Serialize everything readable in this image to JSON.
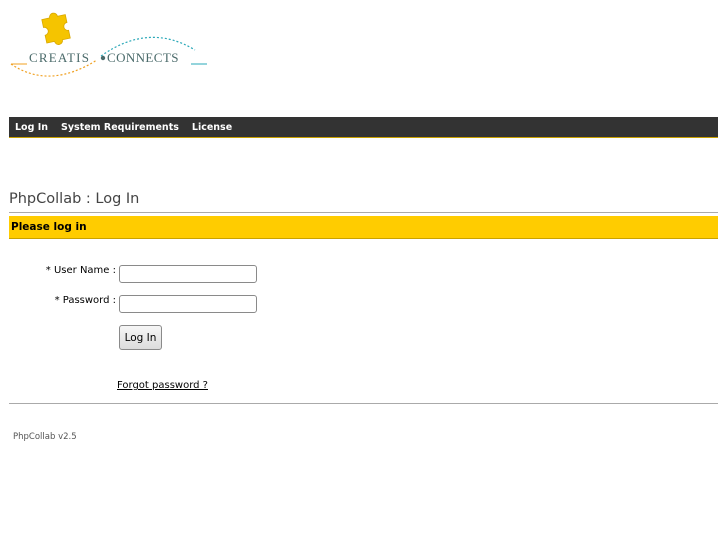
{
  "logo": {
    "brand_left": "CREATIS",
    "brand_right": "CONNECTS",
    "colors": {
      "puzzle": "#f5c400",
      "text": "#4a6a6a",
      "swirl_orange": "#f0a020",
      "swirl_teal": "#2aa8b8"
    }
  },
  "nav": {
    "items": [
      {
        "label": "Log In"
      },
      {
        "label": "System Requirements"
      },
      {
        "label": "License"
      }
    ]
  },
  "page": {
    "title": "PhpCollab : Log In",
    "notice": "Please log in"
  },
  "form": {
    "username_label": "* User Name :",
    "username_value": "",
    "password_label": "* Password :",
    "password_value": "",
    "login_button": "Log In",
    "forgot_link": "Forgot password ?"
  },
  "footer": {
    "version": "PhpCollab v2.5"
  },
  "colors": {
    "navbar": "#333333",
    "notice_bg": "#ffcc00",
    "rule": "#aaaaaa"
  }
}
